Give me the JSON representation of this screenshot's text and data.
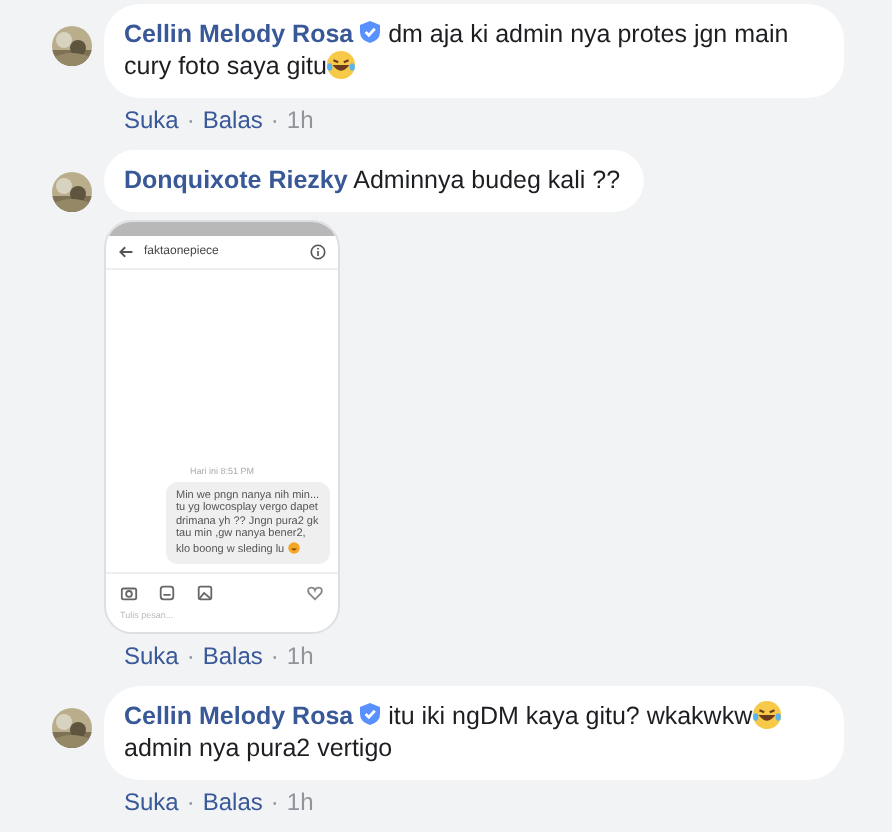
{
  "comments": [
    {
      "author": "Cellin Melody Rosa",
      "verified": true,
      "body": [
        {
          "kind": "text",
          "text": "dm aja ki admin nya protes jgn main cury foto saya gitu"
        },
        {
          "kind": "emoji"
        }
      ],
      "actions": [
        {
          "kind": "link",
          "text": "Suka"
        },
        {
          "kind": "sep",
          "text": "·"
        },
        {
          "kind": "link",
          "text": "Balas"
        },
        {
          "kind": "sep",
          "text": "·"
        },
        {
          "kind": "time",
          "text": "1h"
        }
      ]
    },
    {
      "author": "Donquixote Riezky",
      "verified": false,
      "body": [
        {
          "kind": "text",
          "text": "Adminnya budeg kali ??"
        }
      ],
      "attachment": {
        "kind": "screenshot",
        "title": "faktaonepiece",
        "timestamp": "Hari ini 8:51 PM",
        "message": "Min we pngn nanya nih min... tu yg lowcosplay vergo dapet drimana yh ?? Jngn pura2 gk tau min ,gw nanya bener2, klo boong w sleding lu",
        "placeholder": "Tulis pesan..."
      },
      "actions": [
        {
          "kind": "link",
          "text": "Suka"
        },
        {
          "kind": "sep",
          "text": "·"
        },
        {
          "kind": "link",
          "text": "Balas"
        },
        {
          "kind": "sep",
          "text": "·"
        },
        {
          "kind": "time",
          "text": "1h"
        }
      ]
    },
    {
      "author": "Cellin Melody Rosa",
      "verified": true,
      "body": [
        {
          "kind": "text",
          "text": "itu iki ngDM kaya gitu? wkakwkw"
        },
        {
          "kind": "emoji"
        },
        {
          "kind": "text",
          "text": " admin nya pura2 vertigo"
        }
      ],
      "actions": [
        {
          "kind": "link",
          "text": "Suka"
        },
        {
          "kind": "sep",
          "text": "·"
        },
        {
          "kind": "link",
          "text": "Balas"
        },
        {
          "kind": "sep",
          "text": "·"
        },
        {
          "kind": "time",
          "text": "1h"
        }
      ]
    }
  ]
}
